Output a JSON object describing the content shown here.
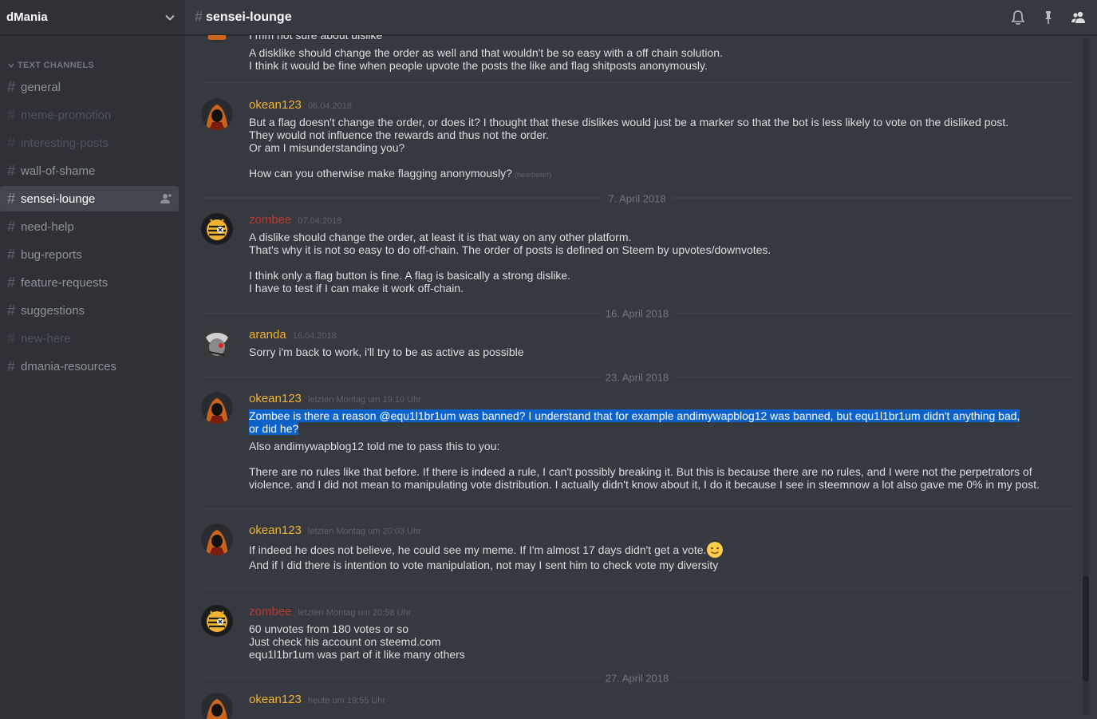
{
  "guild": {
    "name": "dMania"
  },
  "category": {
    "label": "TEXT CHANNELS"
  },
  "channels": [
    {
      "name": "general"
    },
    {
      "name": "meme-promotion"
    },
    {
      "name": "interesting-posts"
    },
    {
      "name": "wall-of-shame"
    },
    {
      "name": "sensei-lounge"
    },
    {
      "name": "need-help"
    },
    {
      "name": "bug-reports"
    },
    {
      "name": "feature-requests"
    },
    {
      "name": "suggestions"
    },
    {
      "name": "new-here"
    },
    {
      "name": "dmania-resources"
    }
  ],
  "header": {
    "channel": "sensei-lounge",
    "icons": [
      "bell-icon",
      "pin-icon",
      "members-icon"
    ]
  },
  "messages": {
    "m0": {
      "lines": [
        "I mm not sure about dislike",
        "A disklike should change the order as well and that wouldn't be so easy with a off chain solution.",
        "I think it would be fine when people upvote the posts the like and flag shitposts anonymously."
      ]
    },
    "m1": {
      "author": "okean123",
      "time": "06.04.2018",
      "lines": [
        "But a flag doesn't change the order, or does it? I thought that these dislikes would just be a marker so that the bot is less likely to vote on the disliked post.",
        "They would not influence the rewards and thus not the order.",
        " Or am I misunderstanding you?",
        "",
        "How can you otherwise make flagging anonymously?"
      ],
      "edited": "(bearbeitet)"
    },
    "d1": "7. April 2018",
    "m2": {
      "author": "zombee",
      "time": "07.04.2018",
      "lines": [
        "A dislike should change the order, at least it is that way on any other platform.",
        "That's why it is not so easy to do off-chain. The order of posts is defined on Steem by upvotes/downvotes.",
        "",
        "I think only a flag button is fine. A flag is basically a strong dislike.",
        "I have to test if I can make it work off-chain."
      ]
    },
    "d2": "16. April 2018",
    "m3": {
      "author": "aranda",
      "time": "16.04.2018",
      "lines": [
        "Sorry i'm back to work, i'll try to be as active as possible"
      ]
    },
    "d3": "23. April 2018",
    "m4": {
      "author": "okean123",
      "time": "letzten Montag um 19:10 Uhr",
      "selected": "Zombee is there a reason @equ1l1br1um was banned? I understand that for example andimywapblog12 was banned, but equ1l1br1um  didn't anything bad, or did he?",
      "lines": [
        "Also andimywapblog12  told me to pass this to you:",
        "",
        "There are no rules like that before. If there is indeed a rule, I can't possibly breaking it. But this is because there are no rules, and I were not the perpetrators of violence. and I did not mean to manipulating vote distribution. I actually didn't know about it, I do it because I see in steemnow a lot also gave me 0% in my post."
      ]
    },
    "m5": {
      "author": "okean123",
      "time": "letzten Montag um 20:03 Uhr",
      "line1": "If indeed he does not believe, he could see my meme. If I'm almost 17 days didn't get a vote.",
      "emoji": "slightly-smiling-face-emoji",
      "line2": "And if I did there is intention to vote manipulation, not may I sent him to check vote my diversity"
    },
    "m6": {
      "author": "zombee",
      "time": "letzten Montag um 20:58 Uhr",
      "lines": [
        "60 unvotes from 180 votes or so",
        "Just check his account on steemd.com",
        "equ1l1br1um was part of it like many others"
      ]
    },
    "d4": "27. April 2018",
    "m7": {
      "author": "okean123",
      "time": "heute um 19:55 Uhr"
    }
  },
  "colors": {
    "background": "#36393f",
    "sidebar": "#2f3136",
    "author_gold": "#f0b232",
    "author_red": "#b93a2e",
    "selection": "#0d62c9"
  }
}
